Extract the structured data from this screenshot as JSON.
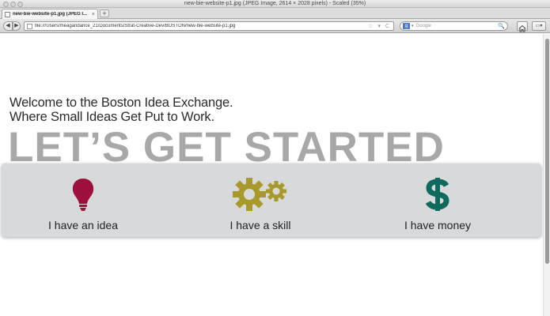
{
  "window": {
    "title": "new-bie-website-p1.jpg (JPEG Image, 2614 × 2028 pixels) - Scaled (35%)"
  },
  "tab": {
    "label": "new-bie-website-p1.jpg (JPEG I...",
    "close": "×",
    "new_tab": "+"
  },
  "navbar": {
    "back": "◀",
    "forward": "▶",
    "url": "file:///Users/meagandance_21/Documents/Strat-Creative-Dev/BOSTON/new-bie-website-p1.jpg",
    "url_icons": "☆ ▾ C",
    "search_engine": "g",
    "search_placeholder": "Google",
    "search_glass": "🔍",
    "toolbar_button": "▭▾"
  },
  "page": {
    "welcome_line1": "Welcome to the Boston Idea Exchange.",
    "welcome_line2": "Where Small Ideas Get Put to Work.",
    "headline": "LET’S GET STARTED",
    "options": [
      {
        "label": "I have an idea",
        "icon": "lightbulb-icon",
        "color": "#9e0f3c"
      },
      {
        "label": "I have a skill",
        "icon": "gears-icon",
        "color": "#a89a2a"
      },
      {
        "label": "I have money",
        "icon": "dollar-icon",
        "color": "#0f6a5e"
      }
    ]
  }
}
